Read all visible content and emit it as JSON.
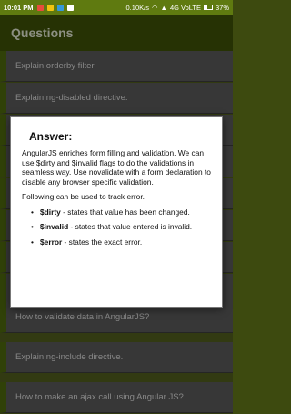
{
  "status_bar": {
    "time": "10:01 PM",
    "speed": "0.10K/s",
    "network": "4G VoLTE",
    "battery": "37%"
  },
  "app_bar": {
    "title": "Questions"
  },
  "list": {
    "items": [
      {
        "label": "Explain orderby filter."
      },
      {
        "label": "Explain ng-disabled directive."
      },
      {
        "label": ""
      },
      {
        "label": ""
      },
      {
        "label": ""
      },
      {
        "label": ""
      },
      {
        "label": ""
      },
      {
        "label": ""
      },
      {
        "label": "How to validate data in AngularJS?"
      },
      {
        "label": "Explain ng-include directive."
      },
      {
        "label": "How to make an ajax call using Angular JS?"
      }
    ]
  },
  "dialog": {
    "title": "Answer:",
    "paragraph1": "AngularJS enriches form filling and validation. We can use $dirty and $invalid flags to do the validations in seamless way. Use novalidate with a form declaration to disable any browser specific validation.",
    "paragraph2": "Following can be used to track error.",
    "points": [
      {
        "term": "$dirty",
        "desc": " - states that value has been changed."
      },
      {
        "term": "$invalid",
        "desc": " - states that value entered is invalid."
      },
      {
        "term": "$error",
        "desc": " - states the exact error."
      }
    ]
  },
  "colors": {
    "status_bar": "#5f7a10",
    "app_bar": "#3b4e07",
    "accent_strip": "#4b650d"
  }
}
